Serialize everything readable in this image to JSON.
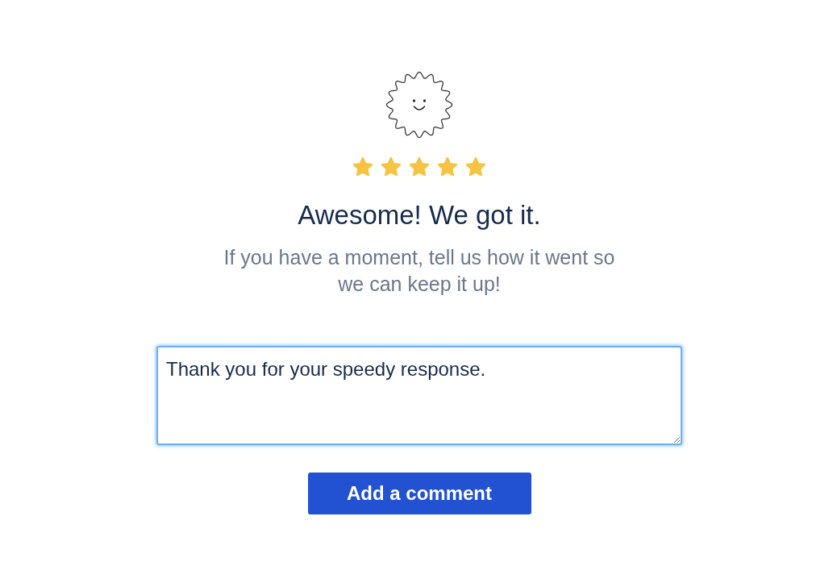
{
  "rating": {
    "stars": 5
  },
  "heading": "Awesome! We got it.",
  "subtitle": "If you have a moment, tell us how it went so we can keep it up!",
  "comment": {
    "value": "Thank you for your speedy response.",
    "focused": true
  },
  "submit_button": "Add a comment"
}
